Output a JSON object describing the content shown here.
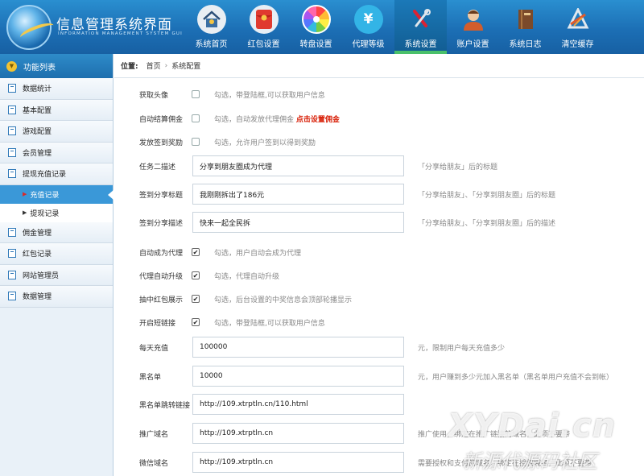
{
  "header": {
    "title": "信息管理系统界面",
    "subtitle": "INFORMATION MANAGEMENT SYSTEM GUI",
    "nav": [
      {
        "label": "系统首页",
        "icon": "home-icon",
        "active": false
      },
      {
        "label": "红包设置",
        "icon": "red-envelope-icon",
        "active": false
      },
      {
        "label": "转盘设置",
        "icon": "wheel-icon",
        "active": false
      },
      {
        "label": "代理等级",
        "icon": "money-icon",
        "active": false
      },
      {
        "label": "系统设置",
        "icon": "tools-icon",
        "active": true
      },
      {
        "label": "账户设置",
        "icon": "user-icon",
        "active": false
      },
      {
        "label": "系统日志",
        "icon": "book-icon",
        "active": false
      },
      {
        "label": "清空缓存",
        "icon": "clear-cache-icon",
        "active": false
      }
    ]
  },
  "sidebar": {
    "heading": "功能列表",
    "items": [
      {
        "label": "数据统计"
      },
      {
        "label": "基本配置"
      },
      {
        "label": "游戏配置"
      },
      {
        "label": "会员管理"
      },
      {
        "label": "提现充值记录"
      }
    ],
    "sub_items": [
      {
        "label": "充值记录",
        "active": true
      },
      {
        "label": "提现记录",
        "active": false
      }
    ],
    "items2": [
      {
        "label": "佣金管理"
      },
      {
        "label": "红包记录"
      },
      {
        "label": "网站管理员"
      },
      {
        "label": "数据管理"
      }
    ]
  },
  "breadcrumb": {
    "label": "位置:",
    "home": "首页",
    "sep": "›",
    "current": "系统配置"
  },
  "form": {
    "check_rows": [
      {
        "label": "获取头像",
        "checked": false,
        "hint": "勾选，带登陆框,可以获取用户信息"
      },
      {
        "label": "自动结算佣金",
        "checked": false,
        "hint": "勾选，自动发放代理佣金",
        "link": "点击设置佣金"
      },
      {
        "label": "发放签到奖励",
        "checked": false,
        "hint": "勾选，允许用户签到以得到奖励"
      }
    ],
    "text_rows": [
      {
        "label": "任务二描述",
        "value": "分享到朋友圈成为代理",
        "after": "「分享给朋友」后的标题"
      },
      {
        "label": "签到分享标题",
        "value": "我刚刚拆出了186元",
        "after": "「分享给朋友」、「分享到朋友圈」后的标题"
      },
      {
        "label": "签到分享描述",
        "value": "快来一起全民拆",
        "after": "「分享给朋友」、「分享到朋友圈」后的描述"
      }
    ],
    "check_rows2": [
      {
        "label": "自动成为代理",
        "checked": true,
        "hint": "勾选，用户自动会成为代理"
      },
      {
        "label": "代理自动升级",
        "checked": true,
        "hint": "勾选，代理自动升级"
      },
      {
        "label": "抽中红包展示",
        "checked": true,
        "hint": "勾选，后台设置的中奖信息会顶部轮播显示"
      },
      {
        "label": "开启短链接",
        "checked": true,
        "hint": "勾选，带登陆框,可以获取用户信息"
      }
    ],
    "text_rows2": [
      {
        "label": "每天充值",
        "value": "100000",
        "after": "元，限制用户每天充值多少"
      },
      {
        "label": "黑名单",
        "value": "10000",
        "after": "元，用户赚到多少元加入黑名单（黑名单用户充值不会到帐）"
      },
      {
        "label": "黑名单跳转链接",
        "value": "http://109.xtrptln.cn/110.html",
        "after": ""
      },
      {
        "label": "推广域名",
        "value": "http://109.xtrptln.cn",
        "after": "推广使用，绑定在推广链接的域名，此项不要带"
      },
      {
        "label": "微信域名",
        "value": "http://109.xtrptln.cn",
        "after": "需要授权和支付的域名，绑定在授权域名，此项不要带"
      }
    ]
  },
  "watermark": {
    "line1": "XYDai.cn",
    "line2": "新源代源码社区"
  }
}
